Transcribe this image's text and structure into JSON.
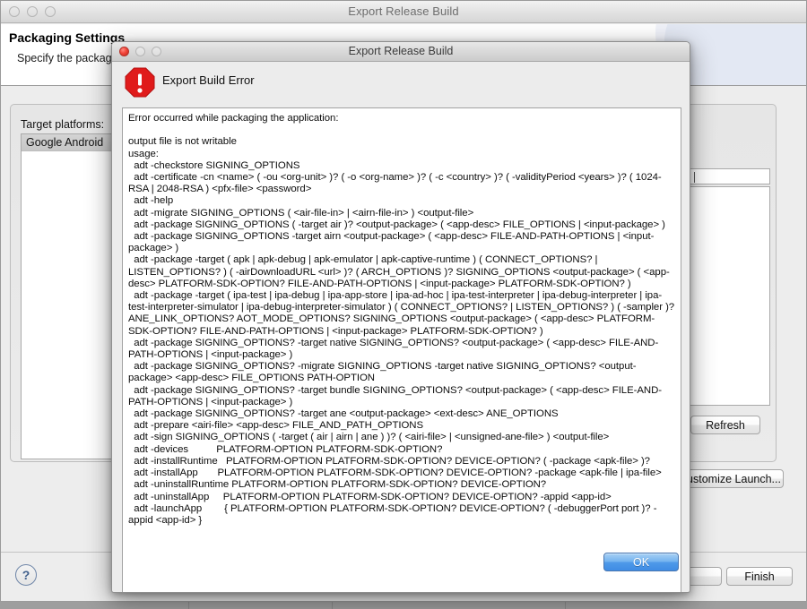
{
  "background_window": {
    "title": "Export Release Build",
    "traffic_lights": [
      "close-button",
      "minimize-button",
      "zoom-button"
    ],
    "header": {
      "title": "Packaging Settings",
      "subtitle": "Specify the packaging settings"
    },
    "fields": {
      "target_platforms_label": "Target platforms:",
      "target_platform_selected": "Google Android"
    },
    "buttons": {
      "refresh": "Refresh",
      "customize_launch": "Customize Launch...",
      "finish": "Finish"
    },
    "help_glyph": "?"
  },
  "error_dialog": {
    "title": "Export Release Build",
    "traffic_lights": [
      "close-button",
      "minimize-button",
      "zoom-button"
    ],
    "heading": "Export Build Error",
    "icon": "error-octagon-icon",
    "ok_label": "OK",
    "message": "Error occurred while packaging the application:\n\noutput file is not writable\nusage:\n  adt -checkstore SIGNING_OPTIONS\n  adt -certificate -cn <name> ( -ou <org-unit> )? ( -o <org-name> )? ( -c <country> )? ( -validityPeriod <years> )? ( 1024-RSA | 2048-RSA ) <pfx-file> <password>\n  adt -help\n  adt -migrate SIGNING_OPTIONS ( <air-file-in> | <airn-file-in> ) <output-file>\n  adt -package SIGNING_OPTIONS ( -target air )? <output-package> ( <app-desc> FILE_OPTIONS | <input-package> )\n  adt -package SIGNING_OPTIONS -target airn <output-package> ( <app-desc> FILE-AND-PATH-OPTIONS | <input-package> )\n  adt -package -target ( apk | apk-debug | apk-emulator | apk-captive-runtime ) ( CONNECT_OPTIONS? | LISTEN_OPTIONS? ) ( -airDownloadURL <url> )? ( ARCH_OPTIONS )? SIGNING_OPTIONS <output-package> ( <app-desc> PLATFORM-SDK-OPTION? FILE-AND-PATH-OPTIONS | <input-package> PLATFORM-SDK-OPTION? )\n  adt -package -target ( ipa-test | ipa-debug | ipa-app-store | ipa-ad-hoc | ipa-test-interpreter | ipa-debug-interpreter | ipa-test-interpreter-simulator | ipa-debug-interpreter-simulator ) ( CONNECT_OPTIONS? | LISTEN_OPTIONS? ) ( -sampler )? ANE_LINK_OPTIONS? AOT_MODE_OPTIONS? SIGNING_OPTIONS <output-package> ( <app-desc> PLATFORM-SDK-OPTION? FILE-AND-PATH-OPTIONS | <input-package> PLATFORM-SDK-OPTION? )\n  adt -package SIGNING_OPTIONS? -target native SIGNING_OPTIONS? <output-package> ( <app-desc> FILE-AND-PATH-OPTIONS | <input-package> )\n  adt -package SIGNING_OPTIONS? -migrate SIGNING_OPTIONS -target native SIGNING_OPTIONS? <output-package> <app-desc> FILE_OPTIONS PATH-OPTION\n  adt -package SIGNING_OPTIONS? -target bundle SIGNING_OPTIONS? <output-package> ( <app-desc> FILE-AND-PATH-OPTIONS | <input-package> )\n  adt -package SIGNING_OPTIONS? -target ane <output-package> <ext-desc> ANE_OPTIONS\n  adt -prepare <airi-file> <app-desc> FILE_AND_PATH_OPTIONS\n  adt -sign SIGNING_OPTIONS ( -target ( air | airn | ane ) )? ( <airi-file> | <unsigned-ane-file> ) <output-file>\n  adt -devices          PLATFORM-OPTION PLATFORM-SDK-OPTION?\n  adt -installRuntime   PLATFORM-OPTION PLATFORM-SDK-OPTION? DEVICE-OPTION? ( -package <apk-file> )?\n  adt -installApp       PLATFORM-OPTION PLATFORM-SDK-OPTION? DEVICE-OPTION? -package <apk-file | ipa-file>\n  adt -uninstallRuntime PLATFORM-OPTION PLATFORM-SDK-OPTION? DEVICE-OPTION?\n  adt -uninstallApp     PLATFORM-OPTION PLATFORM-SDK-OPTION? DEVICE-OPTION? -appid <app-id>\n  adt -launchApp        { PLATFORM-OPTION PLATFORM-SDK-OPTION? DEVICE-OPTION? ( -debuggerPort port )? -appid <app-id> }"
  },
  "colors": {
    "error_red": "#e01b1b",
    "accent_blue": "#4f9ae9",
    "window_chrome": "#ededed",
    "selected_row": "#cccccc"
  }
}
